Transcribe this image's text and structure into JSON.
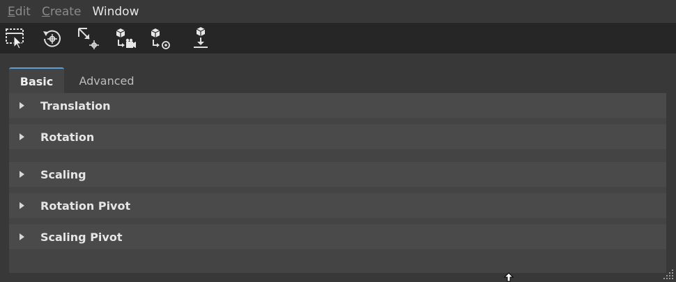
{
  "menu": [
    {
      "prefix": "",
      "mnemonic": "E",
      "rest": "dit"
    },
    {
      "prefix": "",
      "mnemonic": "C",
      "rest": "reate"
    },
    {
      "prefix": "Window",
      "mnemonic": "",
      "rest": ""
    }
  ],
  "toolbar": {
    "icons": [
      "select-layout-icon",
      "reset-transform-icon",
      "scale-pivot-icon",
      "move-to-camera-icon",
      "move-to-pivot-icon",
      "drop-to-ground-icon"
    ]
  },
  "tabs": [
    {
      "label": "Basic",
      "active": true
    },
    {
      "label": "Advanced",
      "active": false
    }
  ],
  "sections": [
    {
      "label": "Translation"
    },
    {
      "label": "Rotation"
    },
    {
      "label": "Scaling"
    },
    {
      "label": "Rotation Pivot"
    },
    {
      "label": "Scaling Pivot"
    }
  ],
  "colors": {
    "background": "#383838",
    "toolbar": "#262626",
    "panel": "#444444",
    "section": "#4a4a4a",
    "tab_accent": "#5e9fd4"
  }
}
